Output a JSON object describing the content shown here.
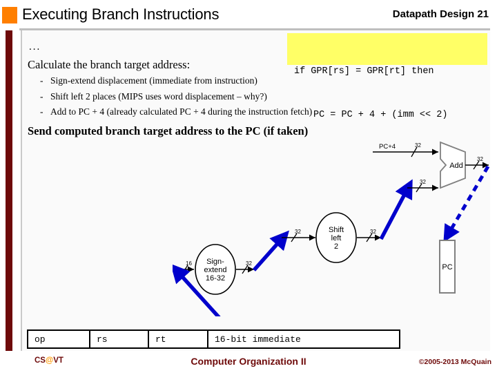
{
  "header": {
    "title": "Executing Branch Instructions",
    "right_label": "Datapath Design",
    "slide_number": "21"
  },
  "code_box": {
    "line1": "if GPR[rs] = GPR[rt] then",
    "line2": "PC = PC + 4 + (imm << 2)",
    "background": "#FFFF66"
  },
  "content": {
    "ellipsis": "...",
    "lead": "Calculate the branch target address:",
    "bullets": [
      "Sign-extend displacement (immediate from instruction)",
      "Shift left 2 places (MIPS uses word displacement – why?)",
      "Add to PC + 4 (already calculated PC + 4 during the instruction fetch)"
    ],
    "bullet_markers": [
      "-",
      "-",
      "-"
    ],
    "closing": "Send computed branch target address to the PC (if taken)"
  },
  "instruction_format": {
    "fields": [
      "op",
      "rs",
      "rt",
      "16-bit immediate"
    ]
  },
  "footer": {
    "left_prefix": "CS",
    "left_at": "@",
    "left_suffix": "VT",
    "center": "Computer Organization II",
    "right": "©2005-2013 McQuain"
  },
  "diagram": {
    "title": "branch-target-datapath",
    "labels": {
      "pc_plus_4": "PC+4",
      "add": "Add",
      "shift_left_2": [
        "Shift",
        "left",
        "2"
      ],
      "sign_extend": [
        "Sign-",
        "extend",
        "16-32"
      ],
      "pc": "PC"
    },
    "bus_widths": {
      "imm_in": "16",
      "sign_extend_out": "32",
      "shift_in": "32",
      "shift_out": "32",
      "add_in_a": "32",
      "add_in_b": "32",
      "add_out": "32"
    },
    "highlight_color": "#0000CC",
    "wire_color": "#000000",
    "box_stroke": "#808080"
  },
  "theme": {
    "accent_orange": "#FF7F00",
    "accent_dark_red": "#6E0A0A",
    "rule_gray": "#bfbfbf",
    "panel_bg": "#FAFAFA"
  }
}
